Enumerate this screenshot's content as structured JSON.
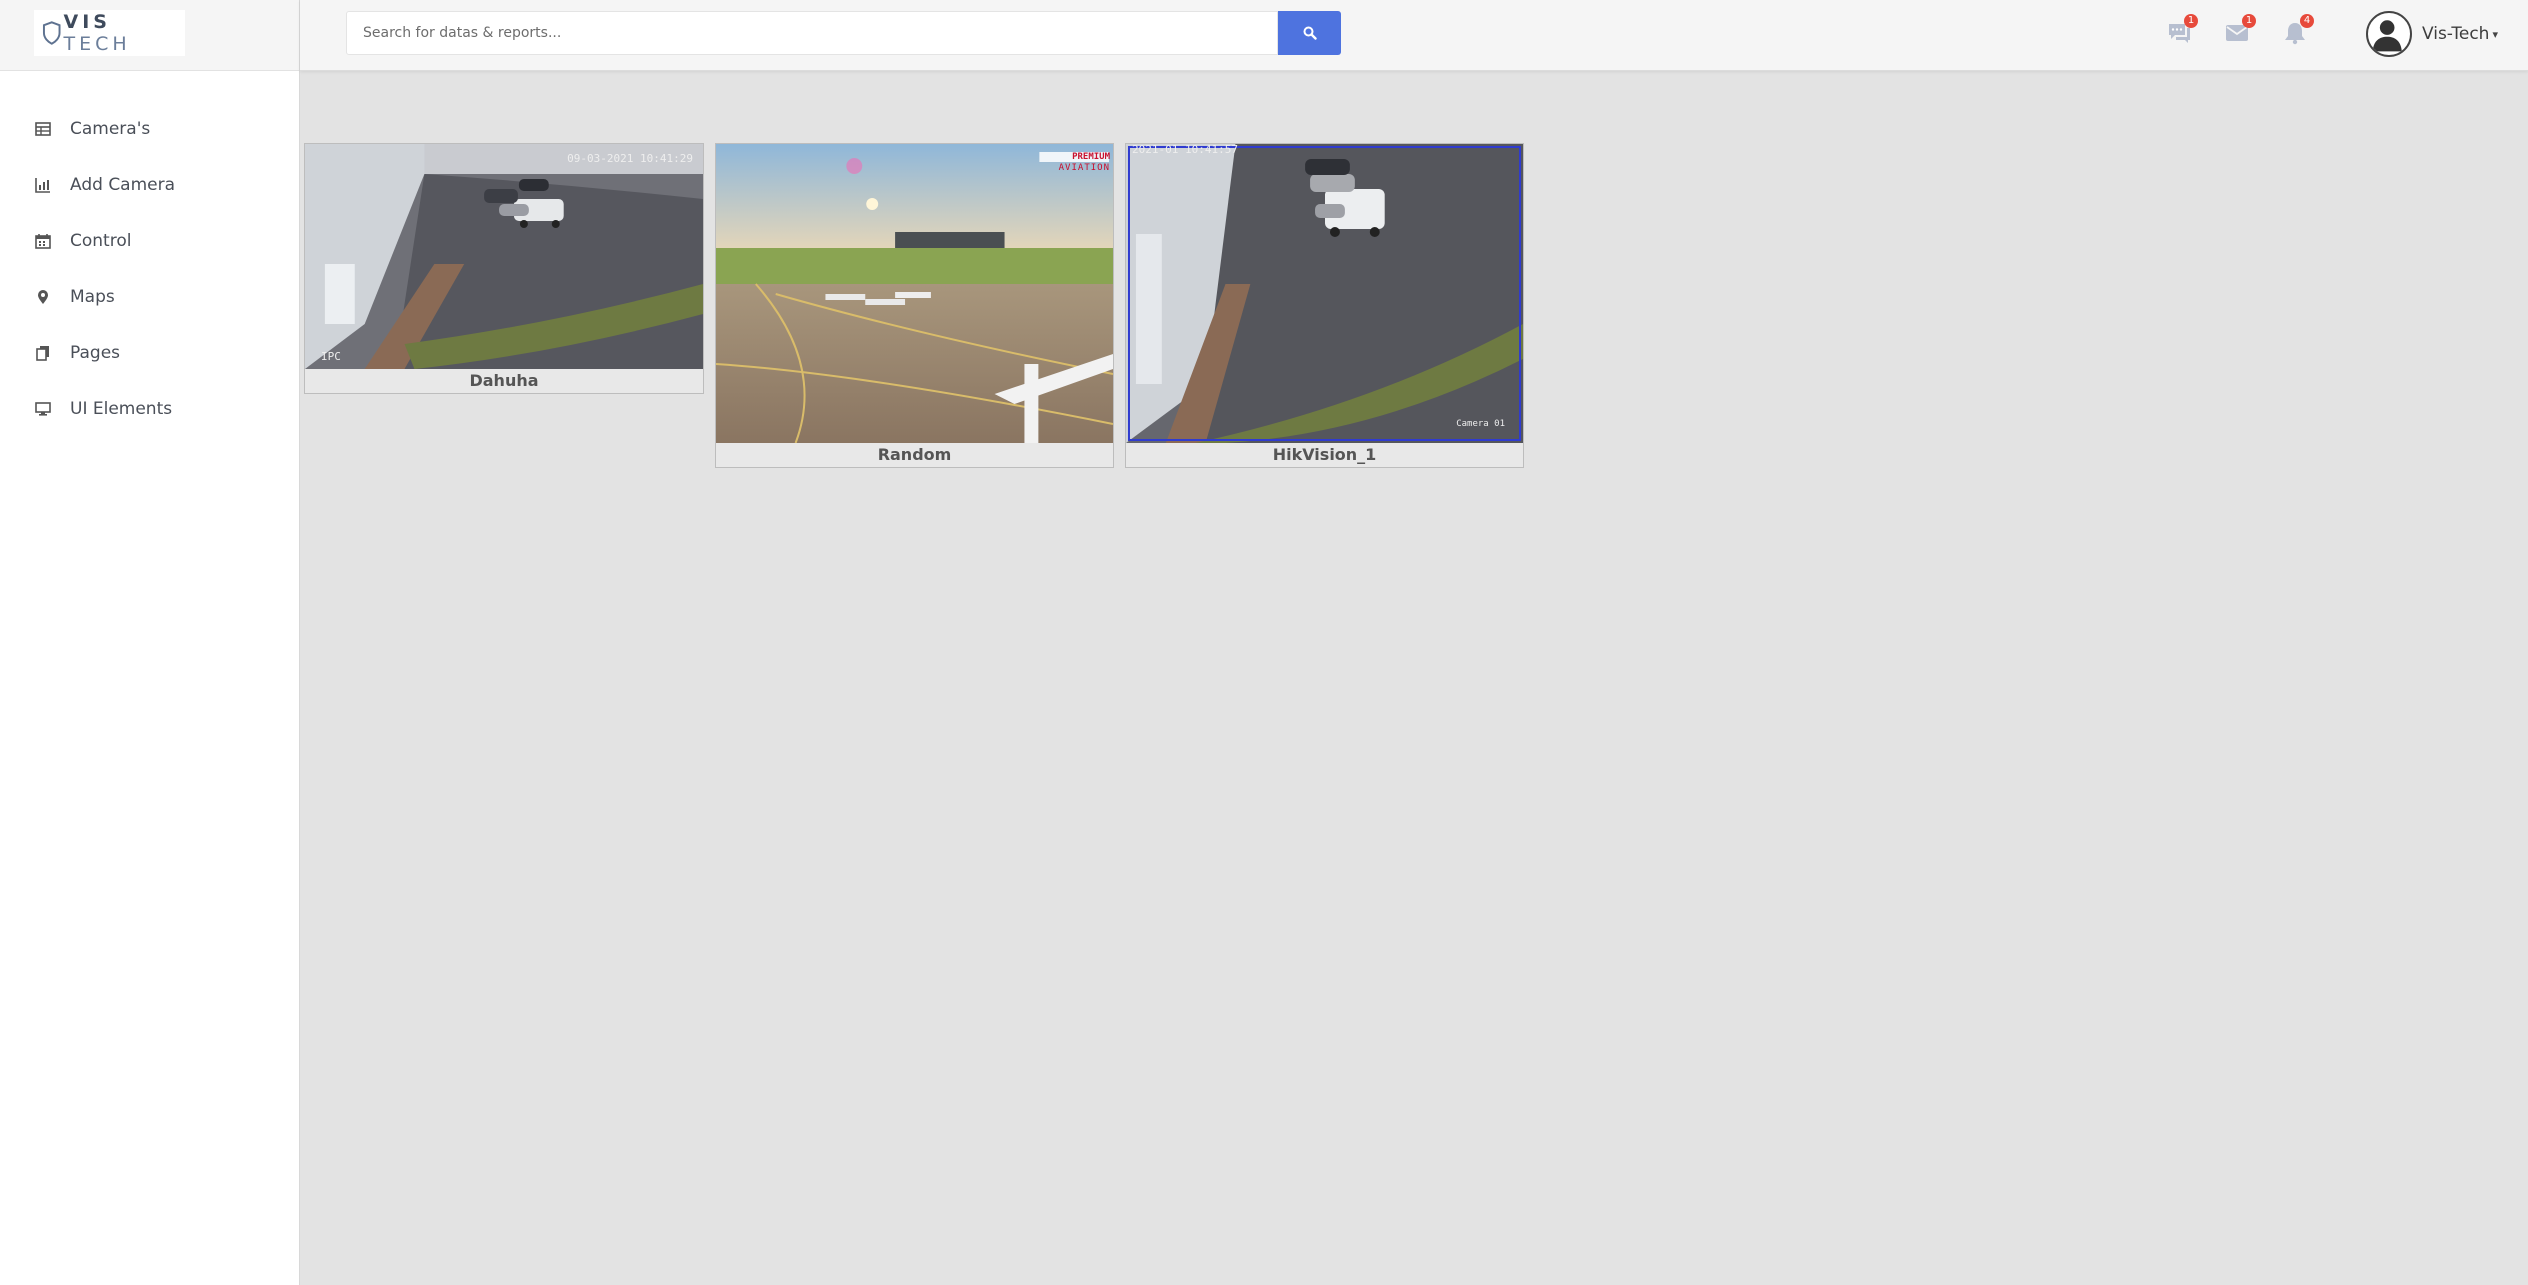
{
  "brand": {
    "logo_text_1": "VIS",
    "logo_text_2": "TECH"
  },
  "sidebar": {
    "items": [
      {
        "label": "Camera's",
        "icon": "table-icon"
      },
      {
        "label": "Add Camera",
        "icon": "bar-chart-icon"
      },
      {
        "label": "Control",
        "icon": "calendar-icon"
      },
      {
        "label": "Maps",
        "icon": "map-marker-icon"
      },
      {
        "label": "Pages",
        "icon": "copy-icon"
      },
      {
        "label": "UI Elements",
        "icon": "desktop-icon"
      }
    ]
  },
  "topbar": {
    "search_placeholder": "Search for datas & reports...",
    "messages_badge": "1",
    "mail_badge": "1",
    "alerts_badge": "4",
    "username": "Vis-Tech",
    "accent_color": "#4e73df",
    "badge_color": "#e74a3b"
  },
  "cameras": [
    {
      "name": "Dahuha",
      "timestamp": "09-03-2021 10:41:29",
      "corner_text": "IPC"
    },
    {
      "name": "Random",
      "logo_text_1": "PREMIUM",
      "logo_text_2": "AVIATION"
    },
    {
      "name": "HikVision_1",
      "timestamp": "2021-01 10:41:57",
      "corner_text": "Camera 01"
    }
  ]
}
